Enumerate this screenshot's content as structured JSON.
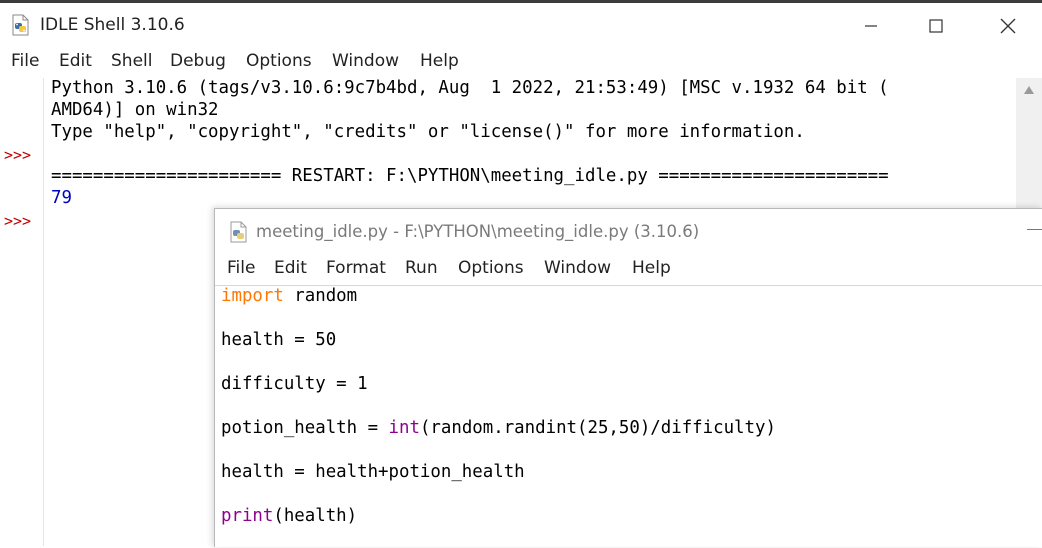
{
  "shell_window": {
    "title": "IDLE Shell 3.10.6",
    "menu": [
      "File",
      "Edit",
      "Shell",
      "Debug",
      "Options",
      "Window",
      "Help"
    ],
    "prompts": [
      ">>>",
      ">>>"
    ],
    "output": {
      "banner_line1": "Python 3.10.6 (tags/v3.10.6:9c7b4bd, Aug  1 2022, 21:53:49) [MSC v.1932 64 bit (",
      "banner_line2": "AMD64)] on win32",
      "banner_line3": "Type \"help\", \"copyright\", \"credits\" or \"license()\" for more information.",
      "restart_line": "====================== RESTART: F:\\PYTHON\\meeting_idle.py ======================",
      "result": "79"
    }
  },
  "editor_window": {
    "title": "meeting_idle.py - F:\\PYTHON\\meeting_idle.py (3.10.6)",
    "menu": [
      "File",
      "Edit",
      "Format",
      "Run",
      "Options",
      "Window",
      "Help"
    ],
    "code": {
      "l1_kw": "import",
      "l1_rest": " random",
      "l2": "health = 50",
      "l3": "difficulty = 1",
      "l4_a": "potion_health = ",
      "l4_bi": "int",
      "l4_b": "(random.randint(25,50)/difficulty)",
      "l5": "health = health+potion_health",
      "l6_bi": "print",
      "l6_b": "(health)"
    }
  },
  "colors": {
    "prompt": "#c00000",
    "stdout": "#0000c0",
    "keyword": "#ff7700",
    "builtin": "#900090"
  },
  "icons": [
    "python-file-icon",
    "minimize-icon",
    "maximize-icon",
    "close-icon",
    "scroll-up-arrow-icon"
  ]
}
